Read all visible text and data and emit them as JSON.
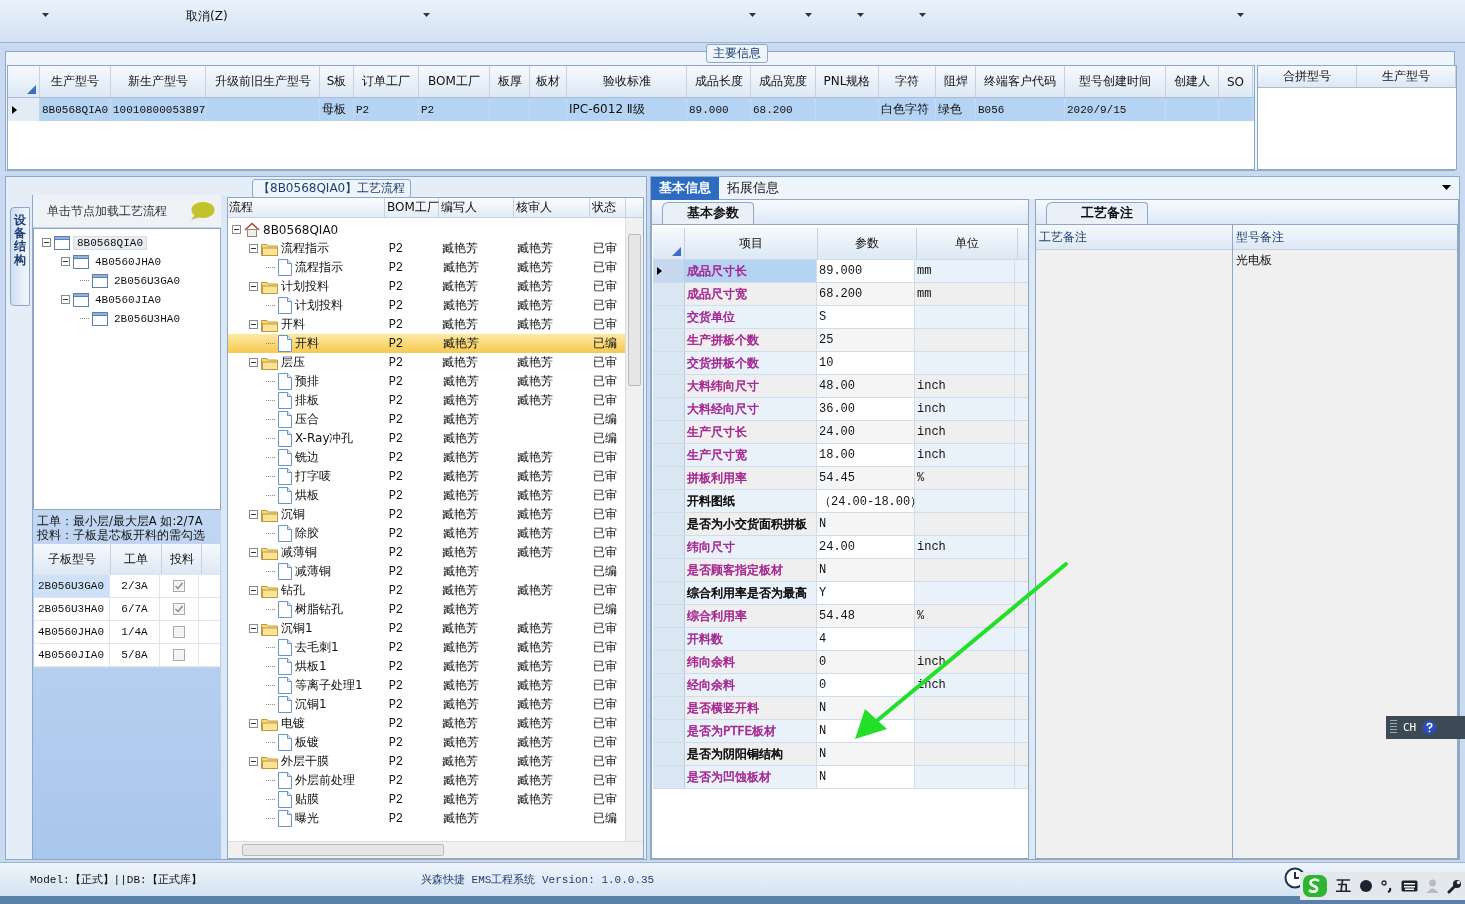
{
  "toolbar": {
    "cancel": "取消(Z)"
  },
  "main_info": {
    "title": "主要信息",
    "columns": [
      "生产型号",
      "新生产型号",
      "升级前旧生产型号",
      "S板",
      "订单工厂",
      "BOM工厂",
      "板厚",
      "板材",
      "验收标准",
      "成品长度",
      "成品宽度",
      "PNL规格",
      "字符",
      "阻焊",
      "终端客户代码",
      "型号创建时间",
      "创建人",
      "SO"
    ],
    "rows": [
      {
        "selected": true,
        "cells": [
          "8B0568QIA0",
          "10010800053897",
          "",
          "母板",
          "P2",
          "P2",
          "",
          "",
          "IPC-6012 Ⅱ级",
          "89.000",
          "68.200",
          "",
          "白色字符",
          "绿色",
          "B056",
          "2020/9/15",
          "",
          ""
        ]
      }
    ],
    "merge_columns": [
      "合拼型号",
      "生产型号"
    ]
  },
  "process": {
    "title": "【8B0568QIA0】工艺流程",
    "side_tab": "设备结构",
    "hint": "单击节点加载工艺流程",
    "tree": [
      {
        "label": "8B0568QIA0",
        "selected": true,
        "expanded": true,
        "children": [
          {
            "label": "4B0560JHA0",
            "selected": false,
            "expanded": true,
            "children": [
              {
                "label": "2B056U3GA0",
                "selected": false
              }
            ]
          },
          {
            "label": "4B0560JIA0",
            "selected": false,
            "expanded": true,
            "children": [
              {
                "label": "2B056U3HA0",
                "selected": false
              }
            ]
          }
        ]
      }
    ],
    "notes": [
      "工单：最小层/最大层A 如:2/7A",
      "投料：子板是芯板开料的需勾选"
    ],
    "sub_table": {
      "columns": [
        "子板型号",
        "工单",
        "投料"
      ],
      "rows": [
        {
          "model": "2B056U3GA0",
          "order": "2/3A",
          "checked": true,
          "selected": true
        },
        {
          "model": "2B056U3HA0",
          "order": "6/7A",
          "checked": true,
          "selected": false
        },
        {
          "model": "4B0560JHA0",
          "order": "1/4A",
          "checked": false,
          "selected": false
        },
        {
          "model": "4B0560JIA0",
          "order": "5/8A",
          "checked": false,
          "selected": false
        }
      ]
    },
    "flow": {
      "columns": [
        "流程",
        "BOM工厂",
        "编写人",
        "核审人",
        "状态"
      ],
      "root": {
        "label": "8B0568QIA0",
        "expanded": true,
        "children": [
          {
            "label": "流程指示",
            "bom": "P2",
            "writer": "臧艳芳",
            "reviewer": "臧艳芳",
            "status": "已审",
            "selected": false,
            "expanded": true,
            "children": [
              {
                "label": "流程指示",
                "bom": "P2",
                "writer": "臧艳芳",
                "reviewer": "臧艳芳",
                "status": "已审",
                "selected": false
              }
            ]
          },
          {
            "label": "计划投料",
            "bom": "P2",
            "writer": "臧艳芳",
            "reviewer": "臧艳芳",
            "status": "已审",
            "selected": false,
            "expanded": true,
            "children": [
              {
                "label": "计划投料",
                "bom": "P2",
                "writer": "臧艳芳",
                "reviewer": "臧艳芳",
                "status": "已审",
                "selected": false
              }
            ]
          },
          {
            "label": "开料",
            "bom": "P2",
            "writer": "臧艳芳",
            "reviewer": "臧艳芳",
            "status": "已审",
            "selected": false,
            "expanded": true,
            "children": [
              {
                "label": "开料",
                "bom": "P2",
                "writer": "臧艳芳",
                "status": "已编",
                "selected": true
              }
            ]
          },
          {
            "label": "层压",
            "bom": "P2",
            "writer": "臧艳芳",
            "reviewer": "臧艳芳",
            "status": "已审",
            "selected": false,
            "expanded": true,
            "children": [
              {
                "label": "预排",
                "bom": "P2",
                "writer": "臧艳芳",
                "reviewer": "臧艳芳",
                "status": "已审",
                "selected": false
              },
              {
                "label": "排板",
                "bom": "P2",
                "writer": "臧艳芳",
                "reviewer": "臧艳芳",
                "status": "已审",
                "selected": false
              },
              {
                "label": "压合",
                "bom": "P2",
                "writer": "臧艳芳",
                "status": "已编",
                "selected": false
              },
              {
                "label": "X-Ray冲孔",
                "bom": "P2",
                "writer": "臧艳芳",
                "status": "已编",
                "selected": false
              },
              {
                "label": "铣边",
                "bom": "P2",
                "writer": "臧艳芳",
                "reviewer": "臧艳芳",
                "status": "已审",
                "selected": false
              },
              {
                "label": "打字唛",
                "bom": "P2",
                "writer": "臧艳芳",
                "reviewer": "臧艳芳",
                "status": "已审",
                "selected": false
              },
              {
                "label": "烘板",
                "bom": "P2",
                "writer": "臧艳芳",
                "reviewer": "臧艳芳",
                "status": "已审",
                "selected": false
              }
            ]
          },
          {
            "label": "沉铜",
            "bom": "P2",
            "writer": "臧艳芳",
            "reviewer": "臧艳芳",
            "status": "已审",
            "selected": false,
            "expanded": true,
            "children": [
              {
                "label": "除胶",
                "bom": "P2",
                "writer": "臧艳芳",
                "reviewer": "臧艳芳",
                "status": "已审",
                "selected": false
              }
            ]
          },
          {
            "label": "减薄铜",
            "bom": "P2",
            "writer": "臧艳芳",
            "reviewer": "臧艳芳",
            "status": "已审",
            "selected": false,
            "expanded": true,
            "children": [
              {
                "label": "减薄铜",
                "bom": "P2",
                "writer": "臧艳芳",
                "status": "已编",
                "selected": false
              }
            ]
          },
          {
            "label": "钻孔",
            "bom": "P2",
            "writer": "臧艳芳",
            "reviewer": "臧艳芳",
            "status": "已审",
            "selected": false,
            "expanded": true,
            "children": [
              {
                "label": "树脂钻孔",
                "bom": "P2",
                "writer": "臧艳芳",
                "status": "已编",
                "selected": false
              }
            ]
          },
          {
            "label": "沉铜1",
            "bom": "P2",
            "writer": "臧艳芳",
            "reviewer": "臧艳芳",
            "status": "已审",
            "selected": false,
            "expanded": true,
            "children": [
              {
                "label": "去毛刺1",
                "bom": "P2",
                "writer": "臧艳芳",
                "reviewer": "臧艳芳",
                "status": "已审",
                "selected": false
              },
              {
                "label": "烘板1",
                "bom": "P2",
                "writer": "臧艳芳",
                "reviewer": "臧艳芳",
                "status": "已审",
                "selected": false
              },
              {
                "label": "等离子处理1",
                "bom": "P2",
                "writer": "臧艳芳",
                "reviewer": "臧艳芳",
                "status": "已审",
                "selected": false
              },
              {
                "label": "沉铜1",
                "bom": "P2",
                "writer": "臧艳芳",
                "reviewer": "臧艳芳",
                "status": "已审",
                "selected": false
              }
            ]
          },
          {
            "label": "电镀",
            "bom": "P2",
            "writer": "臧艳芳",
            "reviewer": "臧艳芳",
            "status": "已审",
            "selected": false,
            "expanded": true,
            "children": [
              {
                "label": "板镀",
                "bom": "P2",
                "writer": "臧艳芳",
                "reviewer": "臧艳芳",
                "status": "已审",
                "selected": false
              }
            ]
          },
          {
            "label": "外层干膜",
            "bom": "P2",
            "writer": "臧艳芳",
            "reviewer": "臧艳芳",
            "status": "已审",
            "selected": false,
            "expanded": true,
            "children": [
              {
                "label": "外层前处理",
                "bom": "P2",
                "writer": "臧艳芳",
                "reviewer": "臧艳芳",
                "status": "已审",
                "selected": false
              },
              {
                "label": "贴膜",
                "bom": "P2",
                "writer": "臧艳芳",
                "reviewer": "臧艳芳",
                "status": "已审",
                "selected": false
              },
              {
                "label": "曝光",
                "bom": "P2",
                "writer": "臧艳芳",
                "status": "已编",
                "selected": false
              }
            ]
          }
        ]
      }
    }
  },
  "info_tabs": [
    {
      "label": "基本信息",
      "selected": true
    },
    {
      "label": "拓展信息",
      "selected": false
    }
  ],
  "basic": {
    "tab": "基本参数",
    "columns": [
      "项目",
      "参数",
      "单位"
    ],
    "rows": [
      {
        "item": "成品尺寸长",
        "value": "89.000",
        "unit": "mm",
        "color": "#a3238e",
        "selected": true
      },
      {
        "item": "成品尺寸宽",
        "value": "68.200",
        "unit": "mm",
        "color": "#a3238e",
        "selected": false
      },
      {
        "item": "交货单位",
        "value": "S",
        "unit": "",
        "color": "#a3238e",
        "selected": false
      },
      {
        "item": "生产拼板个数",
        "value": "25",
        "unit": "",
        "color": "#a3238e",
        "selected": false
      },
      {
        "item": "交货拼板个数",
        "value": "10",
        "unit": "",
        "color": "#a3238e",
        "selected": false
      },
      {
        "item": "大料纬向尺寸",
        "value": "48.00",
        "unit": "inch",
        "color": "#a3238e",
        "selected": false
      },
      {
        "item": "大料经向尺寸",
        "value": "36.00",
        "unit": "inch",
        "color": "#a3238e",
        "selected": false
      },
      {
        "item": "生产尺寸长",
        "value": "24.00",
        "unit": "inch",
        "color": "#a3238e",
        "selected": false
      },
      {
        "item": "生产尺寸宽",
        "value": "18.00",
        "unit": "inch",
        "color": "#a3238e",
        "selected": false
      },
      {
        "item": "拼板利用率",
        "value": "54.45",
        "unit": "%",
        "color": "#a3238e",
        "selected": false
      },
      {
        "item": "开料图纸",
        "value": "（24.00-18.00）",
        "unit": "",
        "color": "#000000",
        "selected": false
      },
      {
        "item": "是否为小交货面积拼板",
        "value": "N",
        "unit": "",
        "color": "#000000",
        "selected": false
      },
      {
        "item": "纬向尺寸",
        "value": "24.00",
        "unit": "inch",
        "color": "#a3238e",
        "selected": false
      },
      {
        "item": "是否顾客指定板材",
        "value": "N",
        "unit": "",
        "color": "#a3238e",
        "selected": false
      },
      {
        "item": "综合利用率是否为最高",
        "value": "Y",
        "unit": "",
        "color": "#000000",
        "selected": false
      },
      {
        "item": "综合利用率",
        "value": "54.48",
        "unit": "%",
        "color": "#a3238e",
        "selected": false
      },
      {
        "item": "开料数",
        "value": "4",
        "unit": "",
        "color": "#a3238e",
        "selected": false
      },
      {
        "item": "纬向余料",
        "value": "0",
        "unit": "inch",
        "color": "#a3238e",
        "selected": false
      },
      {
        "item": "经向余料",
        "value": "0",
        "unit": "inch",
        "color": "#a3238e",
        "selected": false
      },
      {
        "item": "是否横竖开料",
        "value": "N",
        "unit": "",
        "color": "#a3238e",
        "selected": false
      },
      {
        "item": "是否为PTFE板材",
        "value": "N",
        "unit": "",
        "color": "#a3238e",
        "selected": false
      },
      {
        "item": "是否为阴阳铜结构",
        "value": "N",
        "unit": "",
        "color": "#000000",
        "selected": false
      },
      {
        "item": "是否为凹蚀板材",
        "value": "N",
        "unit": "",
        "color": "#a3238e",
        "selected": false
      }
    ]
  },
  "remarks": {
    "tab": "工艺备注",
    "columns": [
      "工艺备注",
      "型号备注"
    ],
    "model_remark": "光电板"
  },
  "status_bar": {
    "model": "Model:【正式】||DB:【正式库】",
    "version": "兴森快捷 EMS工程系统 Version: 1.0.0.35"
  },
  "language_bar": {
    "label": "CH"
  },
  "ime": {
    "label": "五"
  }
}
